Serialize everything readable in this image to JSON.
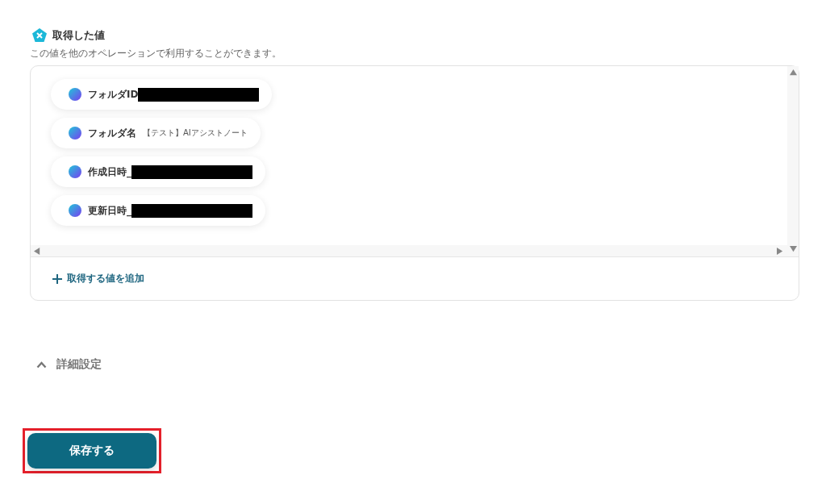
{
  "section": {
    "title": "取得した値",
    "description": "この値を他のオペレーションで利用することができます。"
  },
  "values": [
    {
      "label": "フォルダID",
      "redacted": true
    },
    {
      "label": "フォルダ名",
      "value": "【テスト】AIアシストノート",
      "redacted": false
    },
    {
      "label": "作成日時_",
      "redacted": true
    },
    {
      "label": "更新日時_",
      "redacted": true
    }
  ],
  "add_link": {
    "label": "取得する値を追加"
  },
  "advanced": {
    "label": "詳細設定",
    "expanded": true
  },
  "save_button": {
    "label": "保存する",
    "highlighted": true
  }
}
